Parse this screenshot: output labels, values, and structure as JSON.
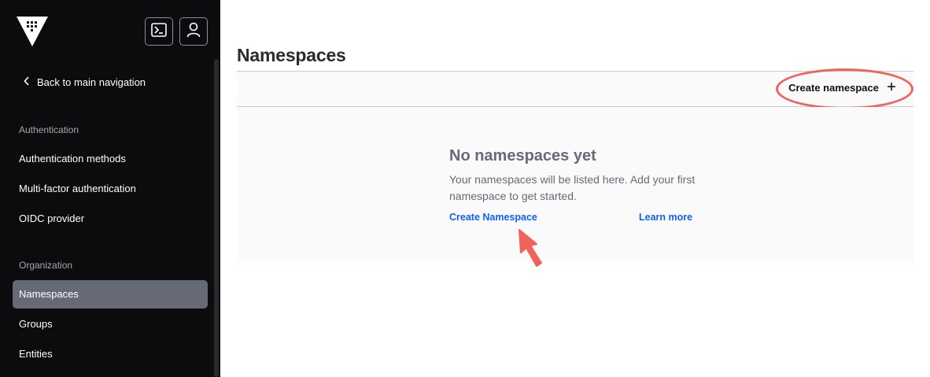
{
  "sidebar": {
    "logo_icon": "vault-logo-icon",
    "console_icon": "terminal-icon",
    "user_icon": "user-icon",
    "back_label": "Back to main navigation",
    "sections": [
      {
        "label": "Authentication",
        "items": [
          "Authentication methods",
          "Multi-factor authentication",
          "OIDC provider"
        ]
      },
      {
        "label": "Organization",
        "items": [
          "Namespaces",
          "Groups",
          "Entities"
        ]
      }
    ],
    "active_item": "Namespaces"
  },
  "main": {
    "title": "Namespaces",
    "toolbar": {
      "create_label": "Create namespace",
      "create_icon": "plus-icon"
    },
    "empty_state": {
      "title": "No namespaces yet",
      "body": "Your namespaces will be listed here. Add your first namespace to get started.",
      "primary_link": "Create Namespace",
      "secondary_link": "Learn more"
    }
  },
  "colors": {
    "sidebar_bg": "#0c0c0e",
    "active_item_bg": "#656a76",
    "link": "#1060ff",
    "annotation": "#f0625a"
  }
}
